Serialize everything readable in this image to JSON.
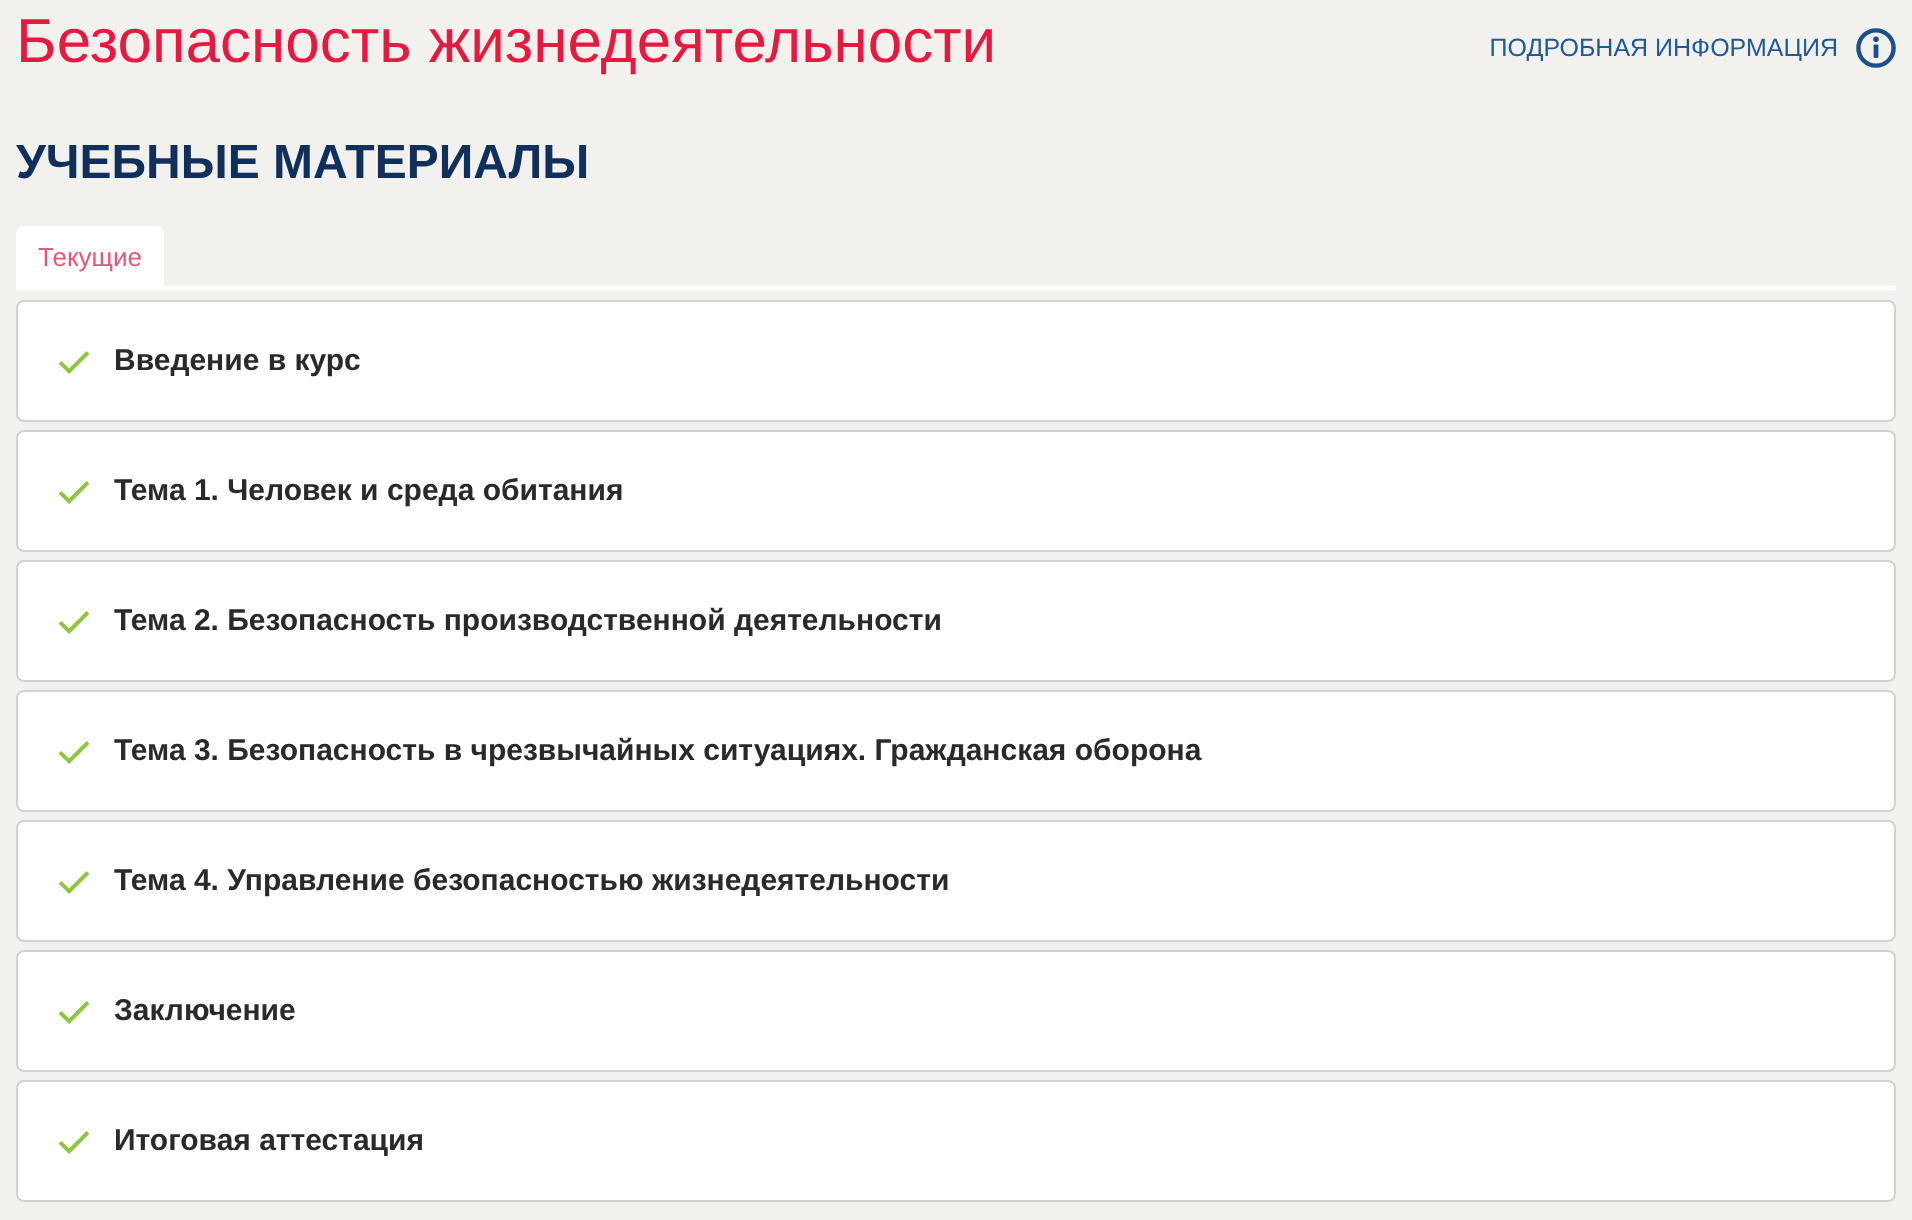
{
  "title": "Безопасность жизнедеятельности",
  "info_link": {
    "label": "ПОДРОБНАЯ ИНФОРМАЦИЯ"
  },
  "section_heading": "УЧЕБНЫЕ МАТЕРИАЛЫ",
  "tabs": [
    {
      "label": "Текущие",
      "selected": true
    }
  ],
  "materials": [
    {
      "title": "Введение в курс",
      "completed": true
    },
    {
      "title": "Тема 1. Человек и среда обитания",
      "completed": true
    },
    {
      "title": "Тема 2. Безопасность производственной деятельности",
      "completed": true
    },
    {
      "title": "Тема 3. Безопасность в чрезвычайных ситуациях. Гражданская оборона",
      "completed": true
    },
    {
      "title": "Тема 4. Управление безопасностью жизнедеятельности",
      "completed": true
    },
    {
      "title": "Заключение",
      "completed": true
    },
    {
      "title": "Итоговая аттестация",
      "completed": true
    }
  ]
}
